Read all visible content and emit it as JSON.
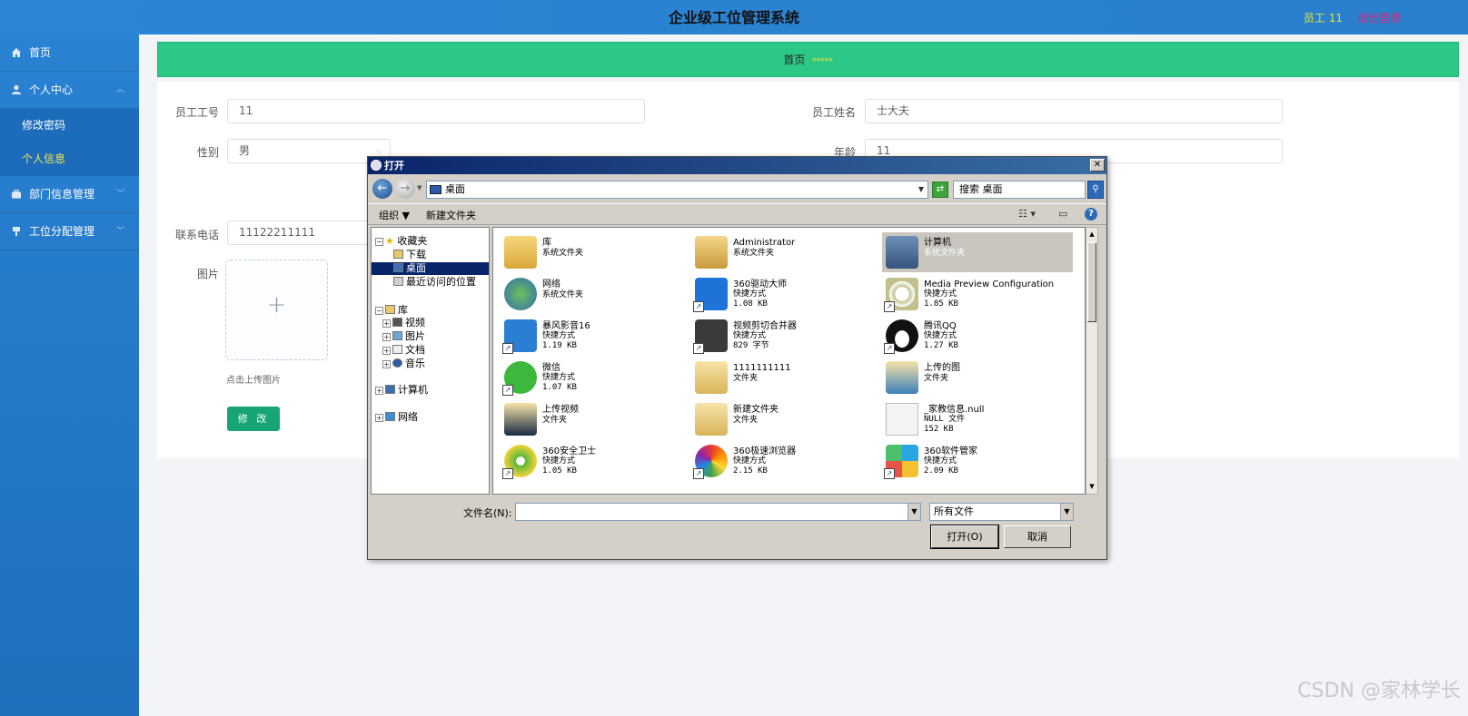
{
  "header": {
    "title": "企业级工位管理系统",
    "user": "员工 11",
    "logout": "退出登录"
  },
  "sidebar": {
    "items": [
      {
        "label": "首页"
      },
      {
        "label": "个人中心",
        "sub": [
          "修改密码",
          "个人信息"
        ]
      },
      {
        "label": "部门信息管理"
      },
      {
        "label": "工位分配管理"
      }
    ]
  },
  "breadcrumb": {
    "home": "首页",
    "sep": "*****"
  },
  "form": {
    "emp_no_label": "员工工号",
    "emp_no": "11",
    "emp_name_label": "员工姓名",
    "emp_name": "士大夫",
    "gender_label": "性别",
    "gender": "男",
    "age_label": "年龄",
    "age": "11",
    "phone_label": "联系电话",
    "phone": "11122211111",
    "image_label": "图片",
    "upload_plus": "+",
    "upload_hint": "点击上传图片",
    "submit": "修 改"
  },
  "watermark": "CSDN @家林学长",
  "dialog": {
    "title": "打开",
    "address": "桌面",
    "search_placeholder": "搜索 桌面",
    "organize": "组织 ▼",
    "new_folder": "新建文件夹",
    "tree": {
      "favorites": "收藏夹",
      "downloads": "下载",
      "desktop": "桌面",
      "recent": "最近访问的位置",
      "libraries": "库",
      "videos": "视频",
      "pictures": "图片",
      "documents": "文档",
      "music": "音乐",
      "computer": "计算机",
      "network": "网络"
    },
    "files": [
      {
        "name": "库",
        "line2": "系统文件夹",
        "line3": ""
      },
      {
        "name": "Administrator",
        "line2": "系统文件夹",
        "line3": ""
      },
      {
        "name": "计算机",
        "line2": "系统文件夹",
        "line3": ""
      },
      {
        "name": "网络",
        "line2": "系统文件夹",
        "line3": ""
      },
      {
        "name": "360驱动大师",
        "line2": "快捷方式",
        "line3": "1.08 KB"
      },
      {
        "name": "Media Preview Configuration",
        "line2": "快捷方式",
        "line3": "1.85 KB"
      },
      {
        "name": "暴风影音16",
        "line2": "快捷方式",
        "line3": "1.19 KB"
      },
      {
        "name": "视频剪切合并器",
        "line2": "快捷方式",
        "line3": "829 字节"
      },
      {
        "name": "腾讯QQ",
        "line2": "快捷方式",
        "line3": "1.27 KB"
      },
      {
        "name": "微信",
        "line2": "快捷方式",
        "line3": "1.07 KB"
      },
      {
        "name": "1111111111",
        "line2": "文件夹",
        "line3": ""
      },
      {
        "name": "上传的图",
        "line2": "文件夹",
        "line3": ""
      },
      {
        "name": "上传视频",
        "line2": "文件夹",
        "line3": ""
      },
      {
        "name": "新建文件夹",
        "line2": "文件夹",
        "line3": ""
      },
      {
        "name": "_家教信息.null",
        "line2": "NULL 文件",
        "line3": "152 KB"
      },
      {
        "name": "360安全卫士",
        "line2": "快捷方式",
        "line3": "1.05 KB"
      },
      {
        "name": "360极速浏览器",
        "line2": "快捷方式",
        "line3": "2.15 KB"
      },
      {
        "name": "360软件管家",
        "line2": "快捷方式",
        "line3": "2.09 KB"
      }
    ],
    "filename_label": "文件名(N):",
    "filename_value": "",
    "filetype": "所有文件",
    "open_btn": "打开(O)",
    "cancel_btn": "取消"
  }
}
